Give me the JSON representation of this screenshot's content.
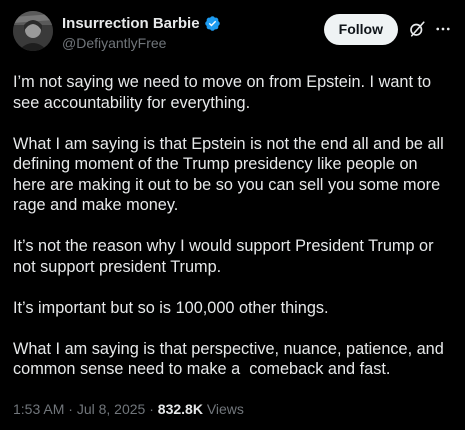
{
  "author": {
    "display_name": "Insurrection Barbie",
    "handle": "@DefiyantlyFree",
    "verified": true
  },
  "actions": {
    "follow_label": "Follow",
    "grok_icon": "grok-slash-icon",
    "more_icon": "ellipsis-icon"
  },
  "tweet": {
    "paragraphs": [
      "I’m not saying we need to move on from Epstein. I want to see accountability for everything.",
      "What I am saying is that Epstein is not the end all and be all defining moment of the Trump presidency like people on here are making it out to be so you can sell you some more rage and make money.",
      "It’s not the reason why I would support President Trump or not support president Trump.",
      "It’s important but so is 100,000 other things.",
      "What I am saying is that perspective, nuance, patience, and common sense need to make a  comeback and fast."
    ],
    "time": "1:53 AM",
    "separator": "·",
    "date": "Jul 8, 2025",
    "views_count": "832.8K",
    "views_label": "Views"
  },
  "colors": {
    "background": "#000000",
    "text_primary": "#e7e9ea",
    "text_secondary": "#71767b",
    "verified_blue": "#1d9bf0",
    "follow_bg": "#eff3f4"
  }
}
